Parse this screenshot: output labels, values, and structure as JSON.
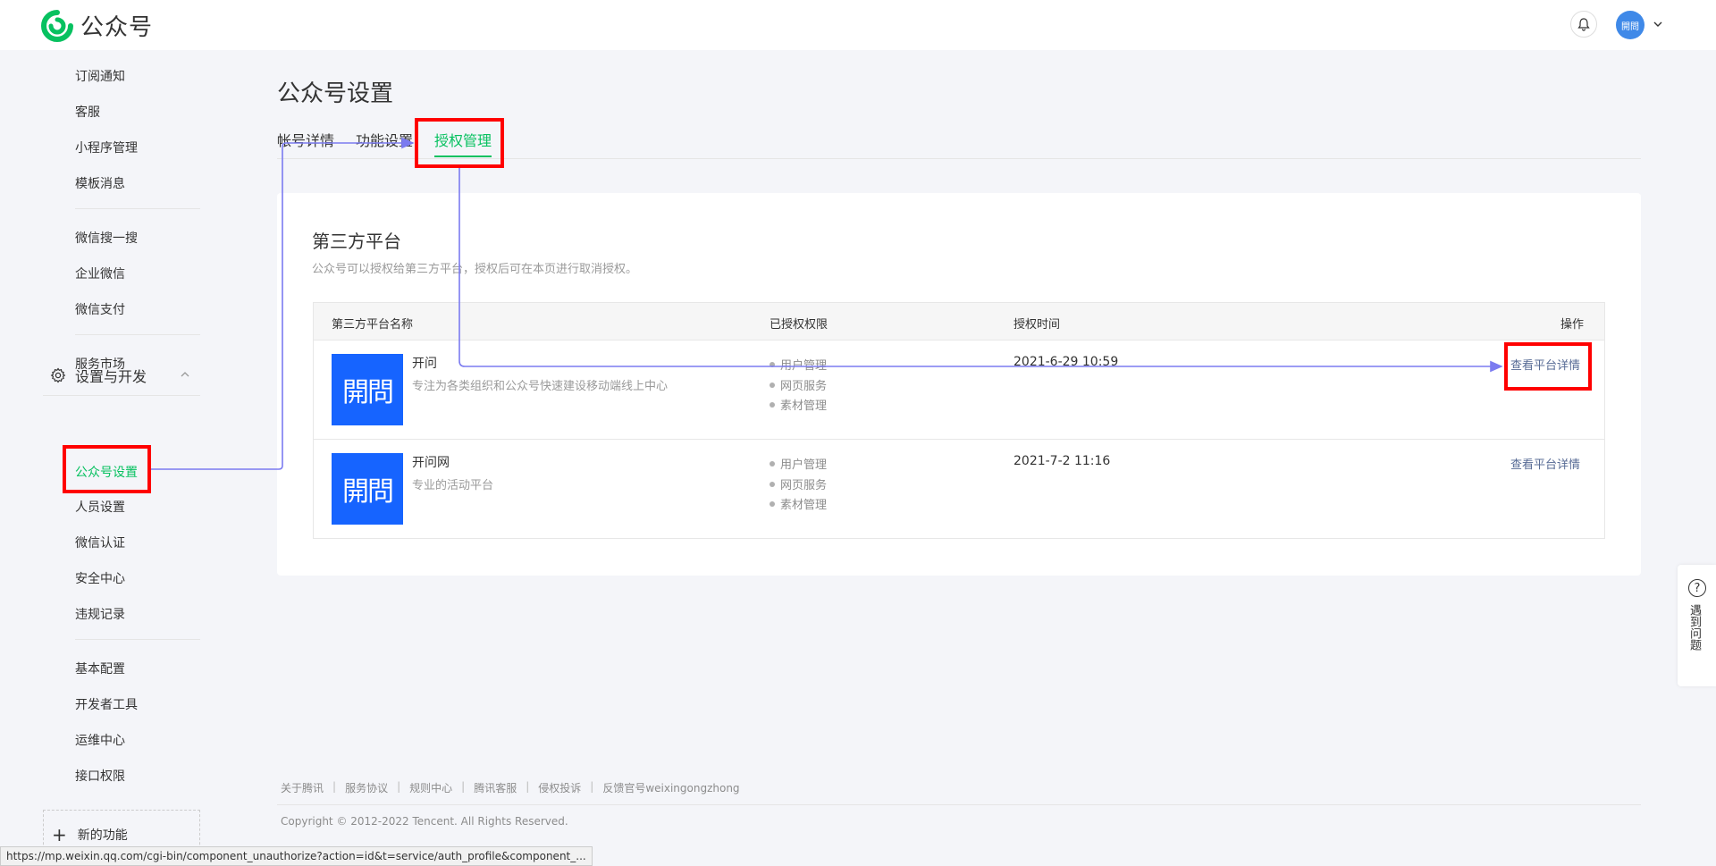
{
  "header": {
    "logo_text": "公众号",
    "avatar_text": "開問"
  },
  "sidebar": {
    "items_top": [
      "订阅通知",
      "客服",
      "小程序管理",
      "模板消息"
    ],
    "items_mid": [
      "微信搜一搜",
      "企业微信",
      "微信支付"
    ],
    "items_market": [
      "服务市场"
    ],
    "group_title": "设置与开发",
    "group_items": [
      "公众号设置",
      "人员设置",
      "微信认证",
      "安全中心",
      "违规记录"
    ],
    "items_dev": [
      "基本配置",
      "开发者工具",
      "运维中心",
      "接口权限"
    ],
    "new_feature": "新的功能"
  },
  "main": {
    "title": "公众号设置",
    "tabs": [
      "帐号详情",
      "功能设置",
      "授权管理"
    ],
    "active_tab": "授权管理",
    "panel": {
      "title": "第三方平台",
      "desc": "公众号可以授权给第三方平台，授权后可在本页进行取消授权。",
      "columns": [
        "第三方平台名称",
        "已授权权限",
        "授权时间",
        "操作"
      ],
      "rows": [
        {
          "logo_text": "開問",
          "name": "开问",
          "desc": "专注为各类组织和公众号快速建设移动端线上中心",
          "permissions": [
            "用户管理",
            "网页服务",
            "素材管理"
          ],
          "time": "2021-6-29 10:59",
          "action": "查看平台详情"
        },
        {
          "logo_text": "開問",
          "name": "开问网",
          "desc": "专业的活动平台",
          "permissions": [
            "用户管理",
            "网页服务",
            "素材管理"
          ],
          "time": "2021-7-2 11:16",
          "action": "查看平台详情"
        }
      ]
    }
  },
  "footer": {
    "links": [
      "关于腾讯",
      "服务协议",
      "规则中心",
      "腾讯客服",
      "侵权投诉",
      "反馈官号weixingongzhong"
    ],
    "copyright": "Copyright © 2012-2022 Tencent. All Rights Reserved."
  },
  "help": {
    "icon": "?",
    "label": "遇到问题"
  },
  "status_bar": {
    "url": "https://mp.weixin.qq.com/cgi-bin/component_unauthorize?action=id&t=service/auth_profile&component_..."
  },
  "colors": {
    "brand_green": "#07c160",
    "link_blue": "#576b95",
    "platform_blue": "#1664ff",
    "highlight_red": "#ff0000",
    "arrow_purple": "#7b7bf0"
  }
}
